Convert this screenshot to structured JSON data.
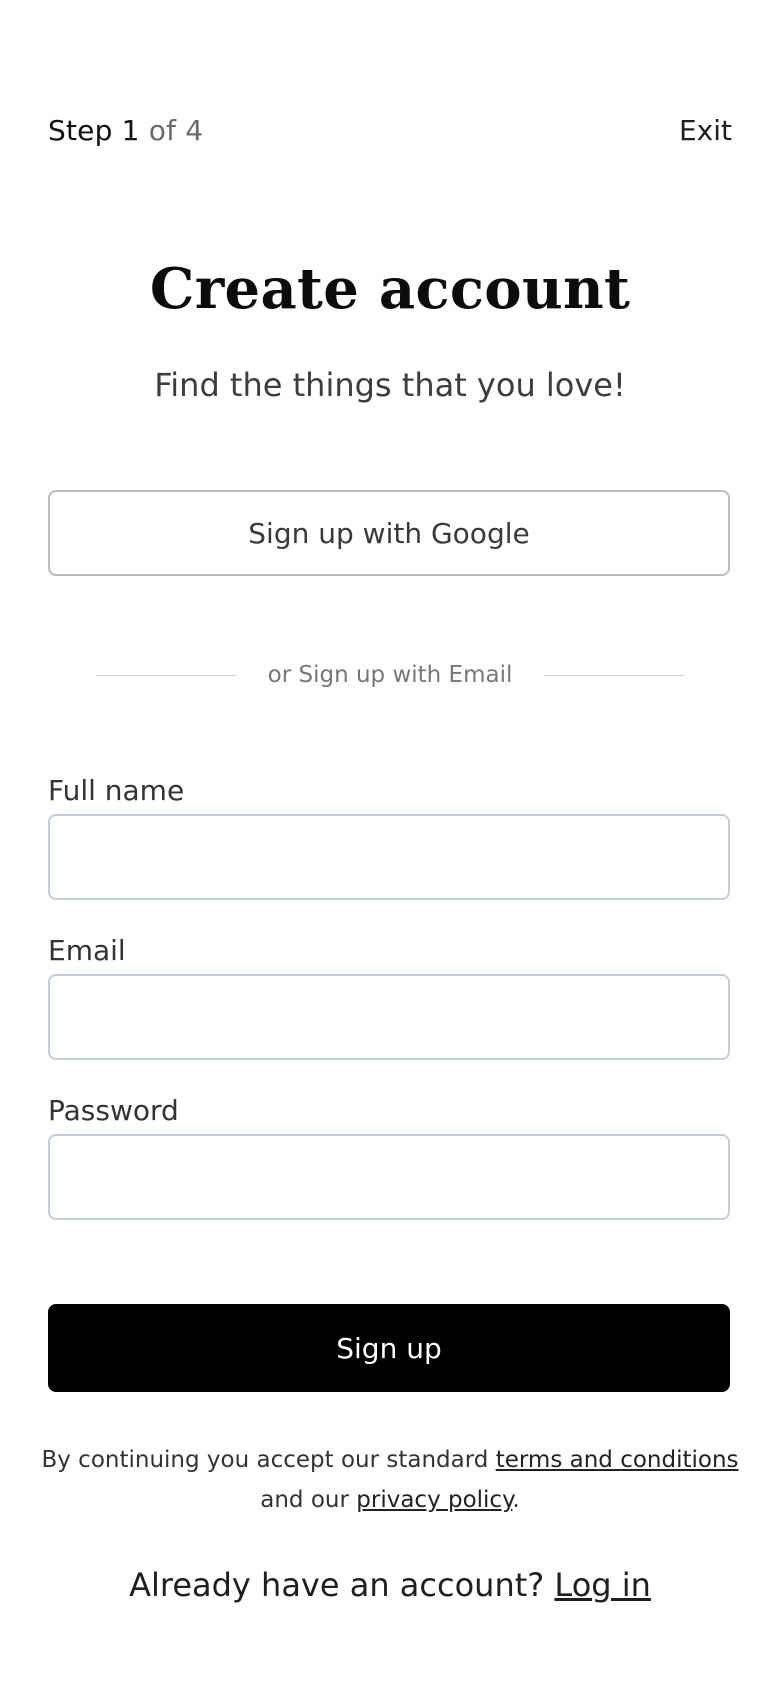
{
  "header": {
    "step_label": "Step",
    "step_current": "1",
    "step_of": "of 4",
    "exit_label": "Exit"
  },
  "title": "Create account",
  "subtitle": "Find the things that you love!",
  "google_button_label": "Sign up with Google",
  "divider_text": "or Sign up with Email",
  "form": {
    "full_name": {
      "label": "Full name",
      "value": "",
      "placeholder": ""
    },
    "email": {
      "label": "Email",
      "value": "",
      "placeholder": ""
    },
    "password": {
      "label": "Password",
      "value": "",
      "placeholder": ""
    }
  },
  "submit_label": "Sign up",
  "legal": {
    "prefix": "By continuing you accept our standard",
    "terms_link": "terms and conditions",
    "middle": "and our",
    "privacy_link": "privacy policy",
    "suffix": "."
  },
  "login_prompt": {
    "text": "Already have an account?",
    "link": "Log in"
  },
  "colors": {
    "primary_button_bg": "#000000",
    "primary_button_text": "#ffffff",
    "input_border": "#c6ccdb",
    "google_button_border": "#bcbcbc"
  }
}
